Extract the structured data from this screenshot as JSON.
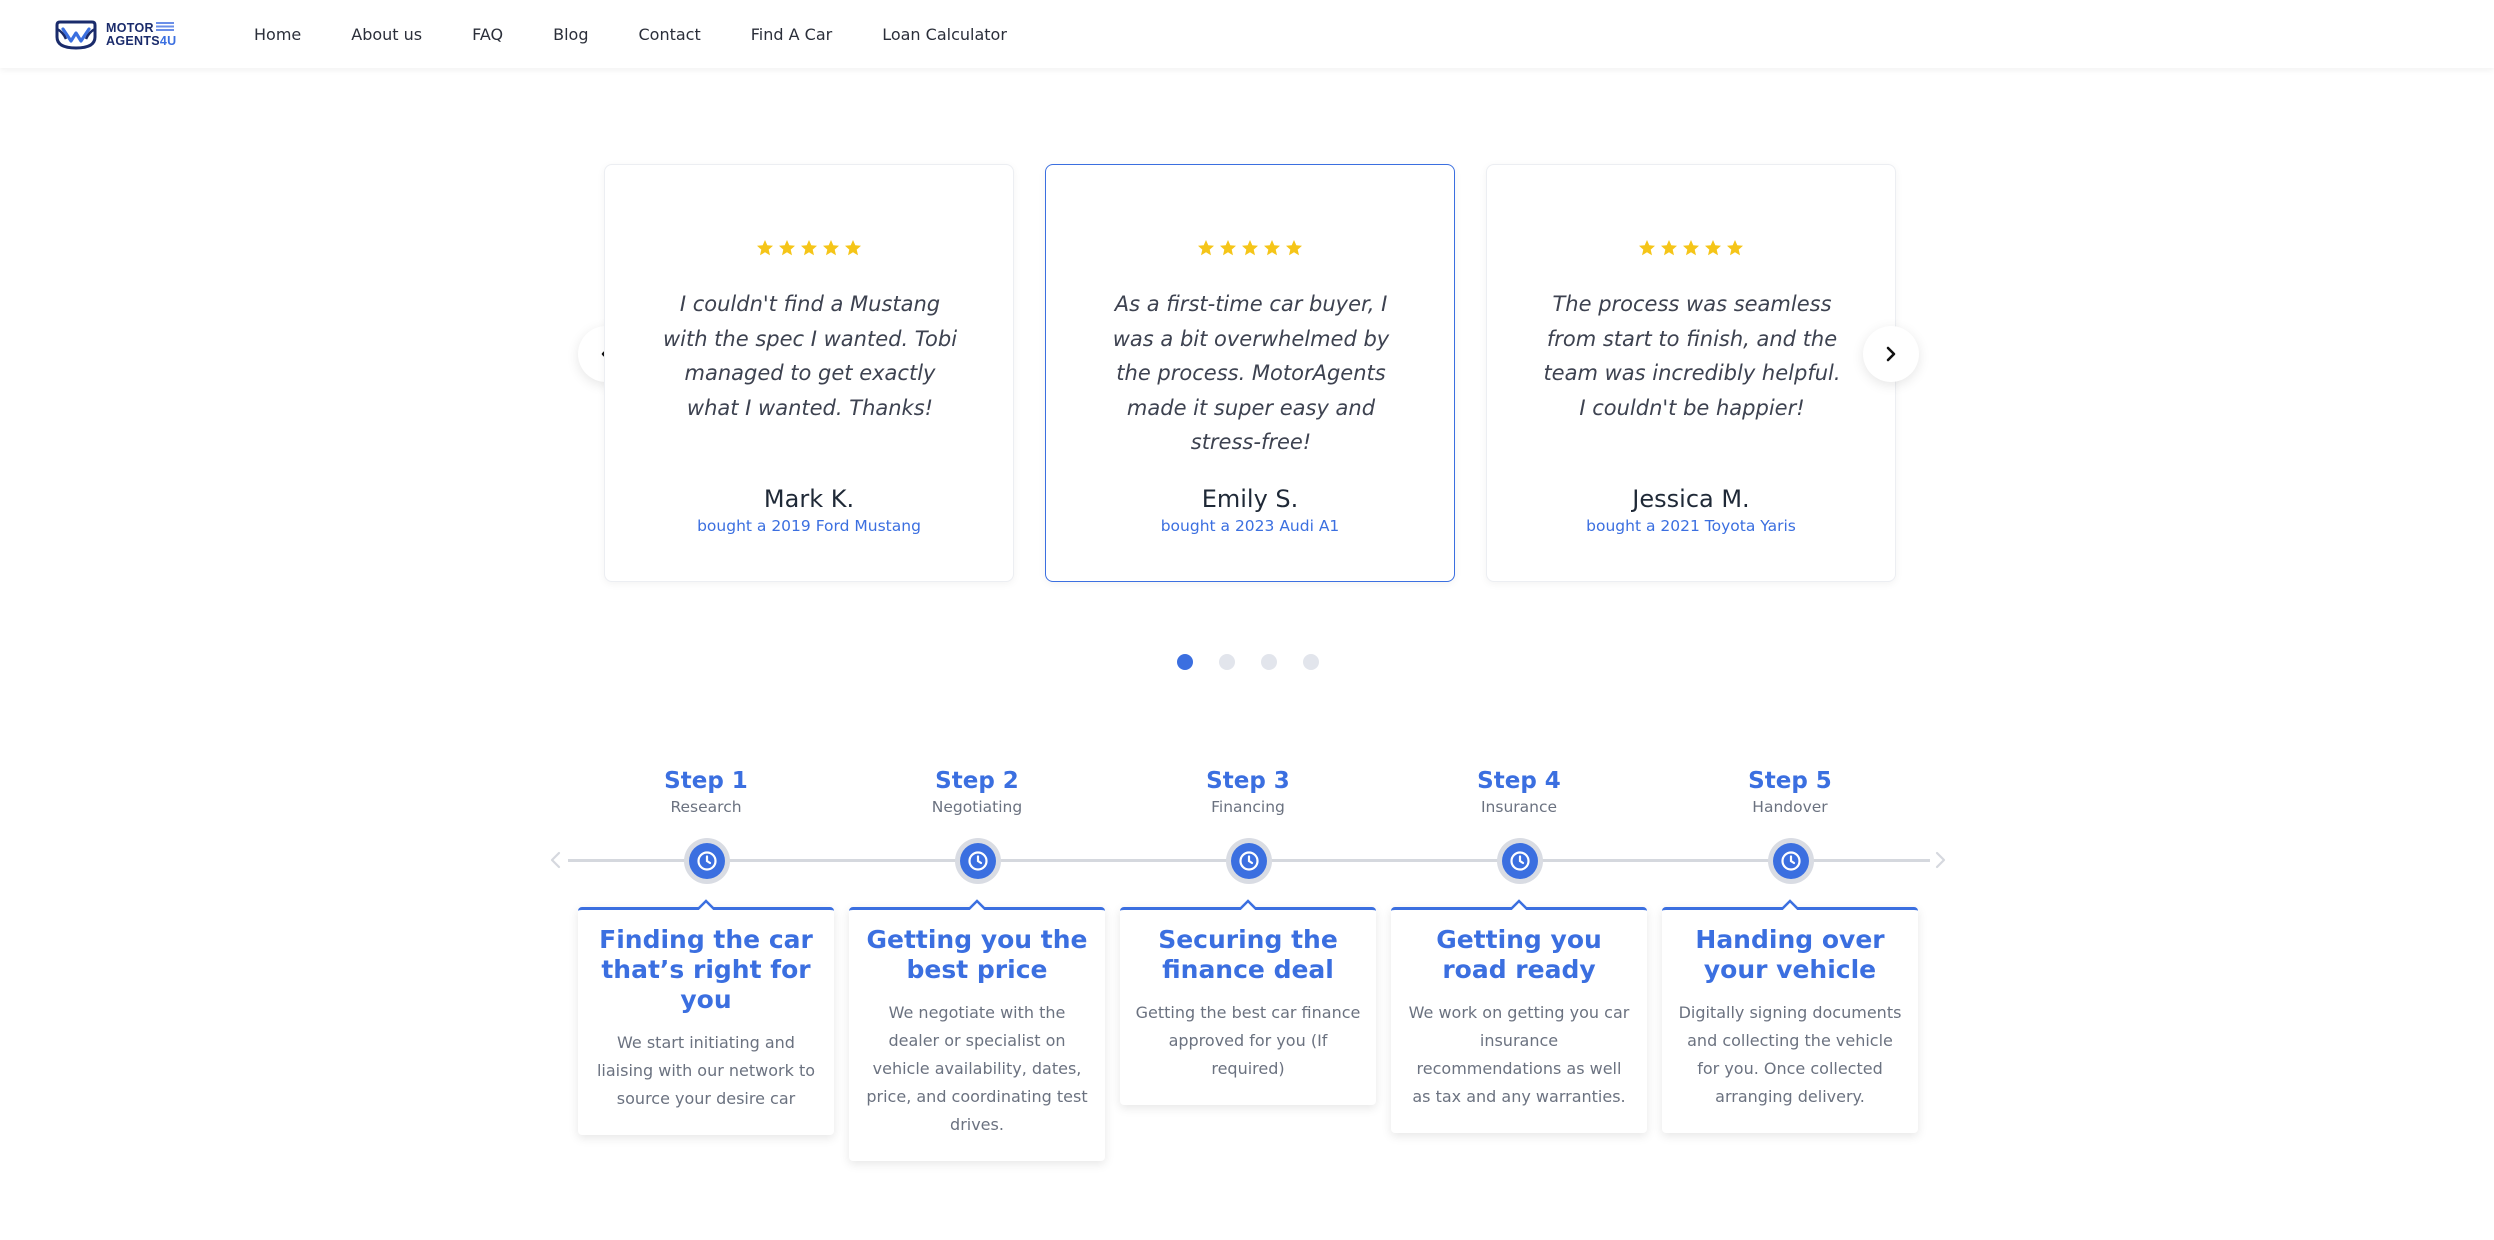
{
  "nav": {
    "logo": {
      "line1": "MOTOR",
      "line2_a": "AGENTS",
      "line2_b": "4U"
    },
    "links": [
      "Home",
      "About us",
      "FAQ",
      "Blog",
      "Contact",
      "Find A Car",
      "Loan Calculator"
    ]
  },
  "testimonials": {
    "items": [
      {
        "rating": 5,
        "quote": "I couldn't find a Mustang with the spec I wanted. Tobi managed to get exactly what I wanted. Thanks!",
        "author": "Mark K.",
        "bought": "bought a 2019 Ford Mustang"
      },
      {
        "rating": 5,
        "quote": "As a first-time car buyer, I was a bit overwhelmed by the process. MotorAgents made it super easy and stress-free!",
        "author": "Emily S.",
        "bought": "bought a 2023 Audi A1"
      },
      {
        "rating": 5,
        "quote": "The process was seamless from start to finish, and the team was incredibly helpful. I couldn't be happier!",
        "author": "Jessica M.",
        "bought": "bought a 2021 Toyota Yaris"
      }
    ],
    "active_index": 1,
    "page_count": 4,
    "active_page": 1,
    "prev_icon": "chevron-left-icon",
    "next_icon": "chevron-right-icon"
  },
  "steps": [
    {
      "label": "Step 1",
      "name": "Research",
      "title": "Finding the car that’s right for you",
      "desc": "We start initiating and liaising with our network to source your desire car"
    },
    {
      "label": "Step 2",
      "name": "Negotiating",
      "title": "Getting you the best price",
      "desc": "We negotiate with the dealer or specialist on vehicle availability, dates, price, and coordinating test drives."
    },
    {
      "label": "Step 3",
      "name": "Financing",
      "title": "Securing the finance deal",
      "desc": "Getting the best car finance approved for you (If required)"
    },
    {
      "label": "Step 4",
      "name": "Insurance",
      "title": "Getting you road ready",
      "desc": "We work on getting you car insurance recommendations as well as tax and any warranties."
    },
    {
      "label": "Step 5",
      "name": "Handover",
      "title": "Handing over your vehicle",
      "desc": "Digitally signing documents and collecting the vehicle for you. Once collected arranging delivery."
    }
  ],
  "colors": {
    "accent": "#3b6fe0",
    "star": "#f5c518",
    "brand_dark": "#1a2b6b"
  }
}
